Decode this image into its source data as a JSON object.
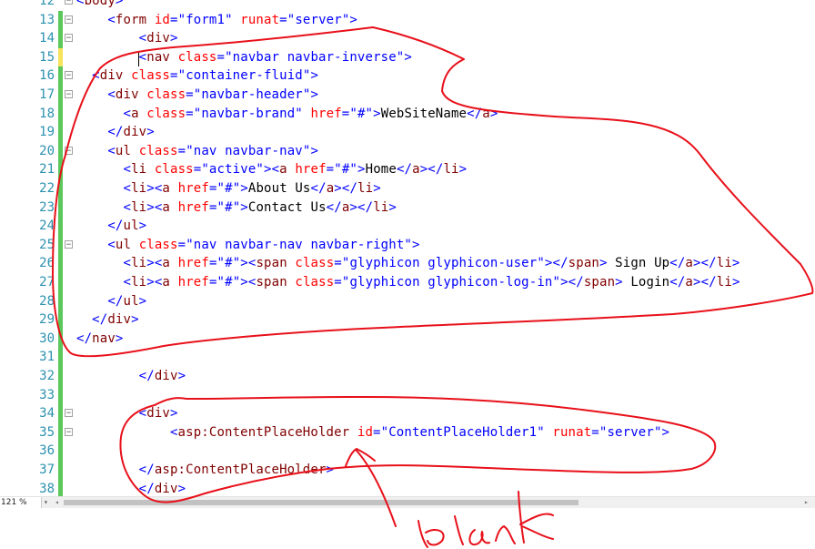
{
  "editor": {
    "lines": [
      {
        "n": "12",
        "marker": "none",
        "fold": "−",
        "tokens": [
          [
            "br",
            "<"
          ],
          [
            "tag",
            "body"
          ],
          [
            "br",
            ">"
          ]
        ]
      },
      {
        "n": "13",
        "marker": "green",
        "fold": "−",
        "tokens": [
          [
            "txt",
            "    "
          ],
          [
            "br",
            "<"
          ],
          [
            "tag",
            "form"
          ],
          [
            "txt",
            " "
          ],
          [
            "attr",
            "id"
          ],
          [
            "br",
            "="
          ],
          [
            "val",
            "\"form1\""
          ],
          [
            "txt",
            " "
          ],
          [
            "attr",
            "runat"
          ],
          [
            "br",
            "="
          ],
          [
            "val",
            "\"server\""
          ],
          [
            "br",
            ">"
          ]
        ]
      },
      {
        "n": "14",
        "marker": "green",
        "fold": "−",
        "tokens": [
          [
            "txt",
            "        "
          ],
          [
            "br",
            "<"
          ],
          [
            "tag",
            "div"
          ],
          [
            "br",
            ">"
          ]
        ]
      },
      {
        "n": "15",
        "marker": "yellow",
        "fold": "",
        "tokens": [
          [
            "txt",
            "        "
          ],
          [
            "br",
            "<"
          ],
          [
            "tag",
            "nav"
          ],
          [
            "txt",
            " "
          ],
          [
            "attr",
            "class"
          ],
          [
            "br",
            "="
          ],
          [
            "val",
            "\"navbar navbar-inverse\""
          ],
          [
            "br",
            ">"
          ]
        ]
      },
      {
        "n": "16",
        "marker": "green",
        "fold": "−",
        "tokens": [
          [
            "txt",
            "  "
          ],
          [
            "br",
            "<"
          ],
          [
            "tag",
            "div"
          ],
          [
            "txt",
            " "
          ],
          [
            "attr",
            "class"
          ],
          [
            "br",
            "="
          ],
          [
            "val",
            "\"container-fluid\""
          ],
          [
            "br",
            ">"
          ]
        ]
      },
      {
        "n": "17",
        "marker": "green",
        "fold": "−",
        "tokens": [
          [
            "txt",
            "    "
          ],
          [
            "br",
            "<"
          ],
          [
            "tag",
            "div"
          ],
          [
            "txt",
            " "
          ],
          [
            "attr",
            "class"
          ],
          [
            "br",
            "="
          ],
          [
            "val",
            "\"navbar-header\""
          ],
          [
            "br",
            ">"
          ]
        ]
      },
      {
        "n": "18",
        "marker": "green",
        "fold": "",
        "tokens": [
          [
            "txt",
            "      "
          ],
          [
            "br",
            "<"
          ],
          [
            "tag",
            "a"
          ],
          [
            "txt",
            " "
          ],
          [
            "attr",
            "class"
          ],
          [
            "br",
            "="
          ],
          [
            "val",
            "\"navbar-brand\""
          ],
          [
            "txt",
            " "
          ],
          [
            "attr",
            "href"
          ],
          [
            "br",
            "="
          ],
          [
            "val",
            "\"#\""
          ],
          [
            "br",
            ">"
          ],
          [
            "txt",
            "WebSiteName"
          ],
          [
            "br",
            "</"
          ],
          [
            "tag",
            "a"
          ],
          [
            "br",
            ">"
          ]
        ]
      },
      {
        "n": "19",
        "marker": "green",
        "fold": "",
        "tokens": [
          [
            "txt",
            "    "
          ],
          [
            "br",
            "</"
          ],
          [
            "tag",
            "div"
          ],
          [
            "br",
            ">"
          ]
        ]
      },
      {
        "n": "20",
        "marker": "green",
        "fold": "−",
        "tokens": [
          [
            "txt",
            "    "
          ],
          [
            "br",
            "<"
          ],
          [
            "tag",
            "ul"
          ],
          [
            "txt",
            " "
          ],
          [
            "attr",
            "class"
          ],
          [
            "br",
            "="
          ],
          [
            "val",
            "\"nav navbar-nav\""
          ],
          [
            "br",
            ">"
          ]
        ]
      },
      {
        "n": "21",
        "marker": "green",
        "fold": "",
        "tokens": [
          [
            "txt",
            "      "
          ],
          [
            "br",
            "<"
          ],
          [
            "tag",
            "li"
          ],
          [
            "txt",
            " "
          ],
          [
            "attr",
            "class"
          ],
          [
            "br",
            "="
          ],
          [
            "val",
            "\"active\""
          ],
          [
            "br",
            "><"
          ],
          [
            "tag",
            "a"
          ],
          [
            "txt",
            " "
          ],
          [
            "attr",
            "href"
          ],
          [
            "br",
            "="
          ],
          [
            "val",
            "\"#\""
          ],
          [
            "br",
            ">"
          ],
          [
            "txt",
            "Home"
          ],
          [
            "br",
            "</"
          ],
          [
            "tag",
            "a"
          ],
          [
            "br",
            "></"
          ],
          [
            "tag",
            "li"
          ],
          [
            "br",
            ">"
          ]
        ]
      },
      {
        "n": "22",
        "marker": "green",
        "fold": "",
        "tokens": [
          [
            "txt",
            "      "
          ],
          [
            "br",
            "<"
          ],
          [
            "tag",
            "li"
          ],
          [
            "br",
            "><"
          ],
          [
            "tag",
            "a"
          ],
          [
            "txt",
            " "
          ],
          [
            "attr",
            "href"
          ],
          [
            "br",
            "="
          ],
          [
            "val",
            "\"#\""
          ],
          [
            "br",
            ">"
          ],
          [
            "txt",
            "About Us"
          ],
          [
            "br",
            "</"
          ],
          [
            "tag",
            "a"
          ],
          [
            "br",
            "></"
          ],
          [
            "tag",
            "li"
          ],
          [
            "br",
            ">"
          ]
        ]
      },
      {
        "n": "23",
        "marker": "green",
        "fold": "",
        "tokens": [
          [
            "txt",
            "      "
          ],
          [
            "br",
            "<"
          ],
          [
            "tag",
            "li"
          ],
          [
            "br",
            "><"
          ],
          [
            "tag",
            "a"
          ],
          [
            "txt",
            " "
          ],
          [
            "attr",
            "href"
          ],
          [
            "br",
            "="
          ],
          [
            "val",
            "\"#\""
          ],
          [
            "br",
            ">"
          ],
          [
            "txt",
            "Contact Us"
          ],
          [
            "br",
            "</"
          ],
          [
            "tag",
            "a"
          ],
          [
            "br",
            "></"
          ],
          [
            "tag",
            "li"
          ],
          [
            "br",
            ">"
          ]
        ]
      },
      {
        "n": "24",
        "marker": "green",
        "fold": "",
        "tokens": [
          [
            "txt",
            "    "
          ],
          [
            "br",
            "</"
          ],
          [
            "tag",
            "ul"
          ],
          [
            "br",
            ">"
          ]
        ]
      },
      {
        "n": "25",
        "marker": "green",
        "fold": "−",
        "tokens": [
          [
            "txt",
            "    "
          ],
          [
            "br",
            "<"
          ],
          [
            "tag",
            "ul"
          ],
          [
            "txt",
            " "
          ],
          [
            "attr",
            "class"
          ],
          [
            "br",
            "="
          ],
          [
            "val",
            "\"nav navbar-nav navbar-right\""
          ],
          [
            "br",
            ">"
          ]
        ]
      },
      {
        "n": "26",
        "marker": "green",
        "fold": "",
        "tokens": [
          [
            "txt",
            "      "
          ],
          [
            "br",
            "<"
          ],
          [
            "tag",
            "li"
          ],
          [
            "br",
            "><"
          ],
          [
            "tag",
            "a"
          ],
          [
            "txt",
            " "
          ],
          [
            "attr",
            "href"
          ],
          [
            "br",
            "="
          ],
          [
            "val",
            "\"#\""
          ],
          [
            "br",
            "><"
          ],
          [
            "tag",
            "span"
          ],
          [
            "txt",
            " "
          ],
          [
            "attr",
            "class"
          ],
          [
            "br",
            "="
          ],
          [
            "val",
            "\"glyphicon glyphicon-user\""
          ],
          [
            "br",
            "></"
          ],
          [
            "tag",
            "span"
          ],
          [
            "br",
            ">"
          ],
          [
            "txt",
            " Sign Up"
          ],
          [
            "br",
            "</"
          ],
          [
            "tag",
            "a"
          ],
          [
            "br",
            "></"
          ],
          [
            "tag",
            "li"
          ],
          [
            "br",
            ">"
          ]
        ]
      },
      {
        "n": "27",
        "marker": "green",
        "fold": "",
        "tokens": [
          [
            "txt",
            "      "
          ],
          [
            "br",
            "<"
          ],
          [
            "tag",
            "li"
          ],
          [
            "br",
            "><"
          ],
          [
            "tag",
            "a"
          ],
          [
            "txt",
            " "
          ],
          [
            "attr",
            "href"
          ],
          [
            "br",
            "="
          ],
          [
            "val",
            "\"#\""
          ],
          [
            "br",
            "><"
          ],
          [
            "tag",
            "span"
          ],
          [
            "txt",
            " "
          ],
          [
            "attr",
            "class"
          ],
          [
            "br",
            "="
          ],
          [
            "val",
            "\"glyphicon glyphicon-log-in\""
          ],
          [
            "br",
            "></"
          ],
          [
            "tag",
            "span"
          ],
          [
            "br",
            ">"
          ],
          [
            "txt",
            " Login"
          ],
          [
            "br",
            "</"
          ],
          [
            "tag",
            "a"
          ],
          [
            "br",
            "></"
          ],
          [
            "tag",
            "li"
          ],
          [
            "br",
            ">"
          ]
        ]
      },
      {
        "n": "28",
        "marker": "green",
        "fold": "",
        "tokens": [
          [
            "txt",
            "    "
          ],
          [
            "br",
            "</"
          ],
          [
            "tag",
            "ul"
          ],
          [
            "br",
            ">"
          ]
        ]
      },
      {
        "n": "29",
        "marker": "green",
        "fold": "",
        "tokens": [
          [
            "txt",
            "  "
          ],
          [
            "br",
            "</"
          ],
          [
            "tag",
            "div"
          ],
          [
            "br",
            ">"
          ]
        ]
      },
      {
        "n": "30",
        "marker": "green",
        "fold": "",
        "tokens": [
          [
            "br",
            "</"
          ],
          [
            "tag",
            "nav"
          ],
          [
            "br",
            ">"
          ]
        ]
      },
      {
        "n": "31",
        "marker": "green",
        "fold": "",
        "tokens": []
      },
      {
        "n": "32",
        "marker": "green",
        "fold": "",
        "tokens": [
          [
            "txt",
            "        "
          ],
          [
            "br",
            "</"
          ],
          [
            "tag",
            "div"
          ],
          [
            "br",
            ">"
          ]
        ]
      },
      {
        "n": "33",
        "marker": "green",
        "fold": "",
        "tokens": []
      },
      {
        "n": "34",
        "marker": "green",
        "fold": "−",
        "tokens": [
          [
            "txt",
            "        "
          ],
          [
            "br",
            "<"
          ],
          [
            "tag",
            "div"
          ],
          [
            "br",
            ">"
          ]
        ]
      },
      {
        "n": "35",
        "marker": "green",
        "fold": "−",
        "tokens": [
          [
            "txt",
            "            "
          ],
          [
            "br",
            "<"
          ],
          [
            "tag",
            "asp:ContentPlaceHolder"
          ],
          [
            "txt",
            " "
          ],
          [
            "attr",
            "id"
          ],
          [
            "br",
            "="
          ],
          [
            "val",
            "\"ContentPlaceHolder1\""
          ],
          [
            "txt",
            " "
          ],
          [
            "attr",
            "runat"
          ],
          [
            "br",
            "="
          ],
          [
            "val",
            "\"server\""
          ],
          [
            "br",
            ">"
          ]
        ]
      },
      {
        "n": "36",
        "marker": "green",
        "fold": "",
        "tokens": []
      },
      {
        "n": "37",
        "marker": "green",
        "fold": "",
        "tokens": [
          [
            "txt",
            "        "
          ],
          [
            "br",
            "</"
          ],
          [
            "tag",
            "asp:ContentPlaceHolder"
          ],
          [
            "br",
            ">"
          ]
        ]
      },
      {
        "n": "38",
        "marker": "green",
        "fold": "",
        "tokens": [
          [
            "txt",
            "        "
          ],
          [
            "br",
            "</"
          ],
          [
            "tag",
            "div"
          ],
          [
            "br",
            ">"
          ]
        ]
      }
    ]
  },
  "statusbar": {
    "zoom": "121 %",
    "zoom_arrow": "▾",
    "scroll_left": "◂",
    "scroll_right": "▸"
  },
  "annotation": {
    "handwritten_text": "blank",
    "ink_color": "#e8101a"
  },
  "colors": {
    "tag": "#800000",
    "attribute": "#ff0000",
    "value": "#0000ff",
    "bracket": "#0000ff",
    "text": "#000000",
    "line_number": "#2b91af",
    "change_marker_green": "#5bc85b",
    "change_marker_yellow": "#f7e35c"
  }
}
